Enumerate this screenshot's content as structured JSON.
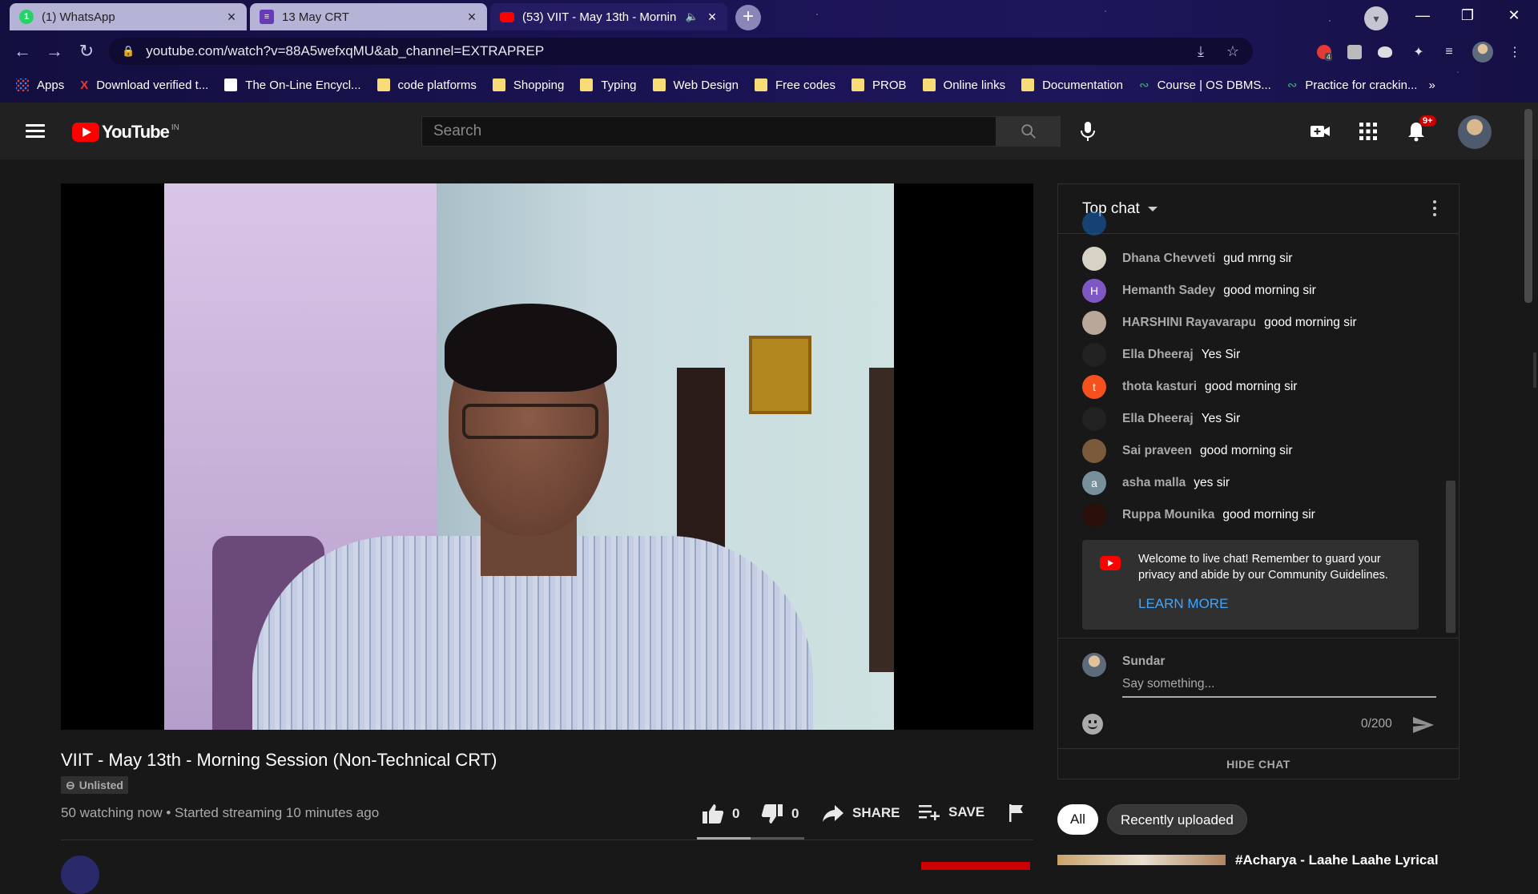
{
  "browser": {
    "tabs": [
      {
        "title": "(1) WhatsApp",
        "icon": "whatsapp-icon",
        "active": false
      },
      {
        "title": "13 May CRT",
        "icon": "forms-icon",
        "active": false
      },
      {
        "title": "(53) VIIT - May 13th - Mornin",
        "icon": "youtube-icon",
        "active": true
      }
    ],
    "new_tab_label": "+",
    "url": "youtube.com/watch?v=88A5wefxqMU&ab_channel=EXTRAPREP",
    "extension_badge": "4",
    "bookmarks": [
      {
        "label": "Apps",
        "icon": "apps-grid-icon"
      },
      {
        "label": "Download verified t...",
        "icon": "x-icon"
      },
      {
        "label": "The On-Line Encycl...",
        "icon": "oeis-icon"
      },
      {
        "label": "code platforms",
        "icon": "folder-icon"
      },
      {
        "label": "Shopping",
        "icon": "folder-icon"
      },
      {
        "label": "Typing",
        "icon": "folder-icon"
      },
      {
        "label": "Web Design",
        "icon": "folder-icon"
      },
      {
        "label": "Free codes",
        "icon": "folder-icon"
      },
      {
        "label": "PROB",
        "icon": "folder-icon"
      },
      {
        "label": "Online links",
        "icon": "folder-icon"
      },
      {
        "label": "Documentation",
        "icon": "folder-icon"
      },
      {
        "label": "Course | OS DBMS...",
        "icon": "course-icon"
      },
      {
        "label": "Practice for crackin...",
        "icon": "course-icon"
      }
    ],
    "more_bookmarks": "»"
  },
  "masthead": {
    "logo_text": "YouTube",
    "country_code": "IN",
    "search_placeholder": "Search",
    "notification_count": "9+"
  },
  "video": {
    "title": "VIIT - May 13th - Morning Session (Non-Technical CRT)",
    "privacy_label": "Unlisted",
    "stats": "50 watching now • Started streaming 10 minutes ago",
    "likes": "0",
    "dislikes": "0",
    "share_label": "SHARE",
    "save_label": "SAVE"
  },
  "chat": {
    "header_label": "Top chat",
    "messages": [
      {
        "author": "Dhana Chevveti",
        "text": "gud mrng sir",
        "avatar_letter": "",
        "avatar_color": "#d8d2c6"
      },
      {
        "author": "Hemanth Sadey",
        "text": "good morning sir",
        "avatar_letter": "H",
        "avatar_color": "#7e57c2"
      },
      {
        "author": "HARSHINI Rayavarapu",
        "text": "good morning sir",
        "avatar_letter": "",
        "avatar_color": "#b9a89a"
      },
      {
        "author": "Ella Dheeraj",
        "text": "Yes Sir",
        "avatar_letter": "",
        "avatar_color": "#222222"
      },
      {
        "author": "thota kasturi",
        "text": "good morning sir",
        "avatar_letter": "t",
        "avatar_color": "#f4511e"
      },
      {
        "author": "Ella Dheeraj",
        "text": "Yes Sir",
        "avatar_letter": "",
        "avatar_color": "#222222"
      },
      {
        "author": "Sai praveen",
        "text": "good morning sir",
        "avatar_letter": "",
        "avatar_color": "#7a5a3a"
      },
      {
        "author": "asha malla",
        "text": "yes sir",
        "avatar_letter": "a",
        "avatar_color": "#78909c"
      },
      {
        "author": "Ruppa Mounika",
        "text": "good morning sir",
        "avatar_letter": "",
        "avatar_color": "#2a0f0a"
      }
    ],
    "welcome_text": "Welcome to live chat! Remember to guard your privacy and abide by our Community Guidelines.",
    "learn_more": "LEARN MORE",
    "current_user": "Sundar",
    "input_placeholder": "Say something...",
    "char_counter": "0/200",
    "hide_chat": "HIDE CHAT"
  },
  "chips": [
    "All",
    "Recently uploaded"
  ],
  "recommendation": {
    "title": "#Acharya - Laahe Laahe Lyrical"
  }
}
